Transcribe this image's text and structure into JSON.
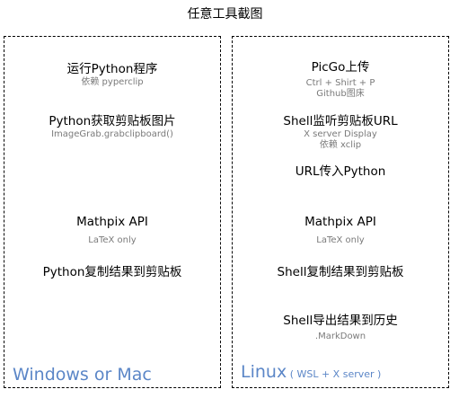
{
  "title": "任意工具截图",
  "colors": {
    "border": "#000000",
    "subtext": "#7a7a7a",
    "platform_label": "#5b86c7"
  },
  "left_panel": {
    "label": "Windows or Mac",
    "steps": [
      {
        "main": "运行Python程序",
        "sub": [
          "依赖 pyperclip"
        ]
      },
      {
        "main": "Python获取剪贴板图片",
        "sub": [
          "ImageGrab.grabclipboard()"
        ]
      },
      {
        "main": "Mathpix API",
        "sub": [
          "LaTeX only"
        ]
      },
      {
        "main": "Python复制结果到剪贴板",
        "sub": []
      }
    ]
  },
  "right_panel": {
    "label": "Linux",
    "label_suffix": " ( WSL + X server )",
    "steps": [
      {
        "main": "PicGo上传",
        "sub": [
          "Ctrl + Shirt + P",
          "Github图床"
        ]
      },
      {
        "main": "Shell监听剪贴板URL",
        "sub": [
          "X server Display",
          "依赖 xclip"
        ]
      },
      {
        "main": "URL传入Python",
        "sub": []
      },
      {
        "main": "Mathpix API",
        "sub": [
          "LaTeX only"
        ]
      },
      {
        "main": "Shell复制结果到剪贴板",
        "sub": []
      },
      {
        "main": "Shell导出结果到历史",
        "sub": [
          ".MarkDown"
        ]
      }
    ]
  }
}
